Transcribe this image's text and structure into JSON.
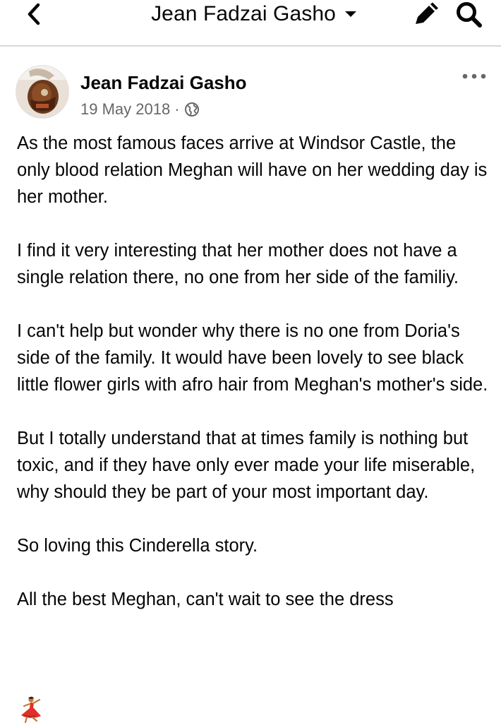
{
  "header": {
    "title": "Jean Fadzai Gasho",
    "icons": {
      "back": "back-arrow-icon",
      "caret": "caret-down-icon",
      "edit": "pencil-icon",
      "search": "search-icon"
    }
  },
  "post": {
    "author": "Jean Fadzai Gasho",
    "date": "19 May 2018",
    "separator": "·",
    "audience_icon": "globe-icon",
    "more_icon": "more-options-icon",
    "paragraphs": [
      "As the most famous faces arrive at Windsor Castle, the only blood relation Meghan will have on her wedding day is her mother.",
      "I find it very interesting that her mother does not have a single relation there, no one from her side of the familiy.",
      "I can't help but wonder why there is no one from Doria's side of the family. It would have been lovely to see black little flower girls with afro hair from Meghan's mother's side.",
      "But I totally understand that at times family is nothing but toxic, and if they have only ever made your life miserable, why should they be part of your most important day.",
      "So loving this Cinderella story.",
      "All the best Meghan, can't wait to see the dress"
    ],
    "emoji": "dancer-emoji"
  }
}
